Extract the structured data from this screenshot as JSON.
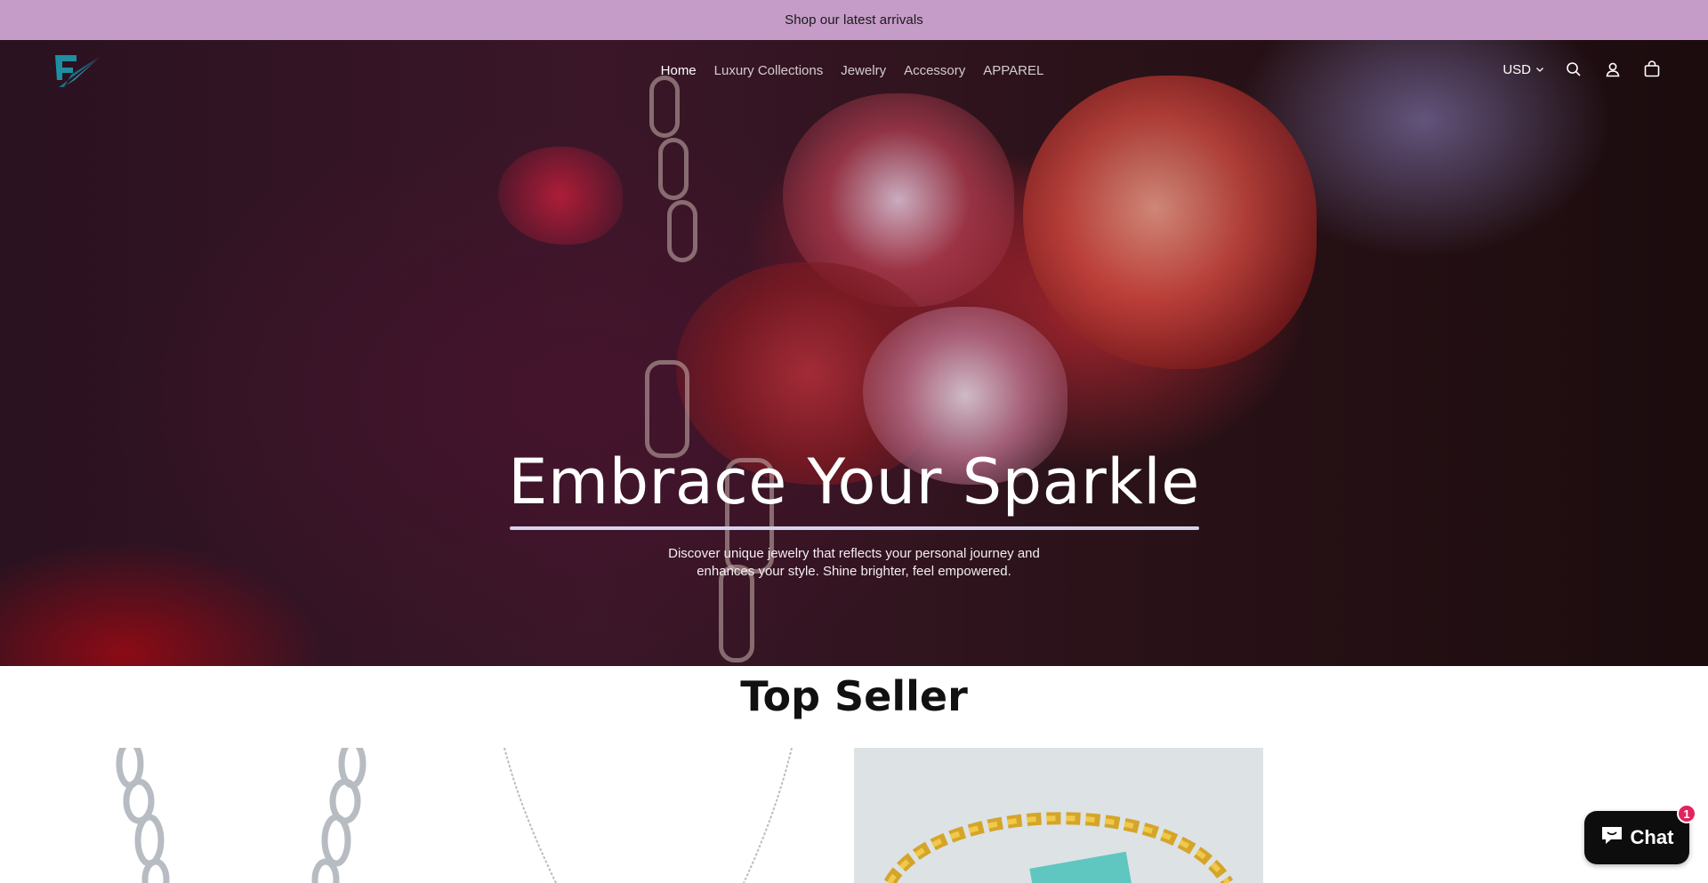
{
  "announcement": {
    "text": "Shop our latest arrivals"
  },
  "header": {
    "logo_icon": "brand-logo-icon",
    "nav": [
      {
        "label": "Home",
        "active": true
      },
      {
        "label": "Luxury Collections",
        "active": false
      },
      {
        "label": "Jewelry",
        "active": false
      },
      {
        "label": "Accessory",
        "active": false
      },
      {
        "label": "APPAREL",
        "active": false
      }
    ],
    "currency": {
      "label": "USD",
      "icon": "chevron-down-icon"
    },
    "icons": [
      "search-icon",
      "account-icon",
      "cart-icon"
    ]
  },
  "hero": {
    "title": "Embrace Your Sparkle",
    "subtitle": "Discover unique jewelry that reflects your personal journey and enhances your style. Shine brighter, feel empowered."
  },
  "top_seller": {
    "title": "Top Seller"
  },
  "chat": {
    "label": "Chat",
    "badge": "1",
    "icon": "chat-bubble-icon"
  },
  "colors": {
    "announcement_bg": "#c59bc7",
    "brand_teal": "#1f8ea0",
    "chat_bg": "#0d0d0d",
    "badge": "#e0245e"
  }
}
